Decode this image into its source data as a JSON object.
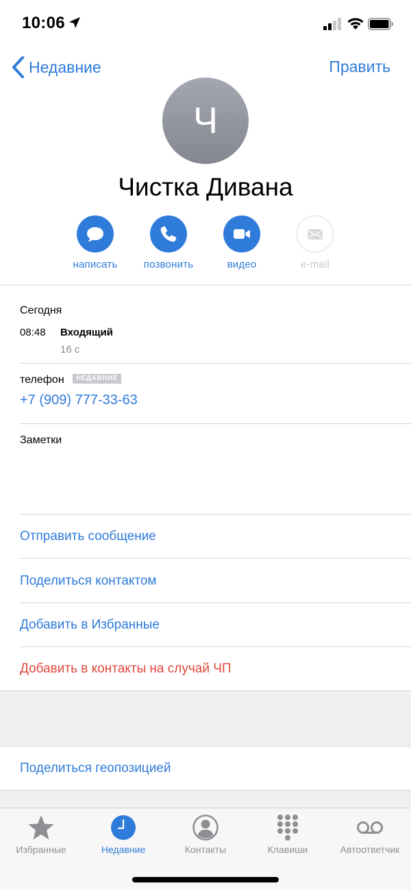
{
  "status_bar": {
    "time": "10:06"
  },
  "nav": {
    "back_label": "Недавние",
    "edit_label": "Править"
  },
  "contact": {
    "avatar_initial": "Ч",
    "name": "Чистка Дивана"
  },
  "actions": [
    {
      "label": "написать",
      "icon": "message-icon",
      "enabled": true
    },
    {
      "label": "позвонить",
      "icon": "phone-icon",
      "enabled": true
    },
    {
      "label": "видео",
      "icon": "video-icon",
      "enabled": true
    },
    {
      "label": "e-mail",
      "icon": "mail-icon",
      "enabled": false
    }
  ],
  "recent_calls": {
    "day": "Сегодня",
    "time": "08:48",
    "type": "Входящий",
    "duration": "16 с"
  },
  "phone": {
    "label": "телефон",
    "badge": "НЕДАВНИЕ",
    "number": "+7 (909) 777-33-63"
  },
  "notes": {
    "label": "Заметки"
  },
  "options": {
    "send_message": "Отправить сообщение",
    "share_contact": "Поделиться контактом",
    "add_favorites": "Добавить в Избранные",
    "add_emergency": "Добавить в контакты на случай ЧП",
    "share_location": "Поделиться геопозицией"
  },
  "tabs": [
    {
      "label": "Избранные",
      "icon": "star-icon",
      "active": false
    },
    {
      "label": "Недавние",
      "icon": "clock-icon",
      "active": true
    },
    {
      "label": "Контакты",
      "icon": "person-icon",
      "active": false
    },
    {
      "label": "Клавиши",
      "icon": "keypad-icon",
      "active": false
    },
    {
      "label": "Автоответчик",
      "icon": "voicemail-icon",
      "active": false
    }
  ],
  "colors": {
    "accent": "#2f7bd9",
    "destructive": "#e0483d",
    "inactive": "#8e8e93"
  }
}
